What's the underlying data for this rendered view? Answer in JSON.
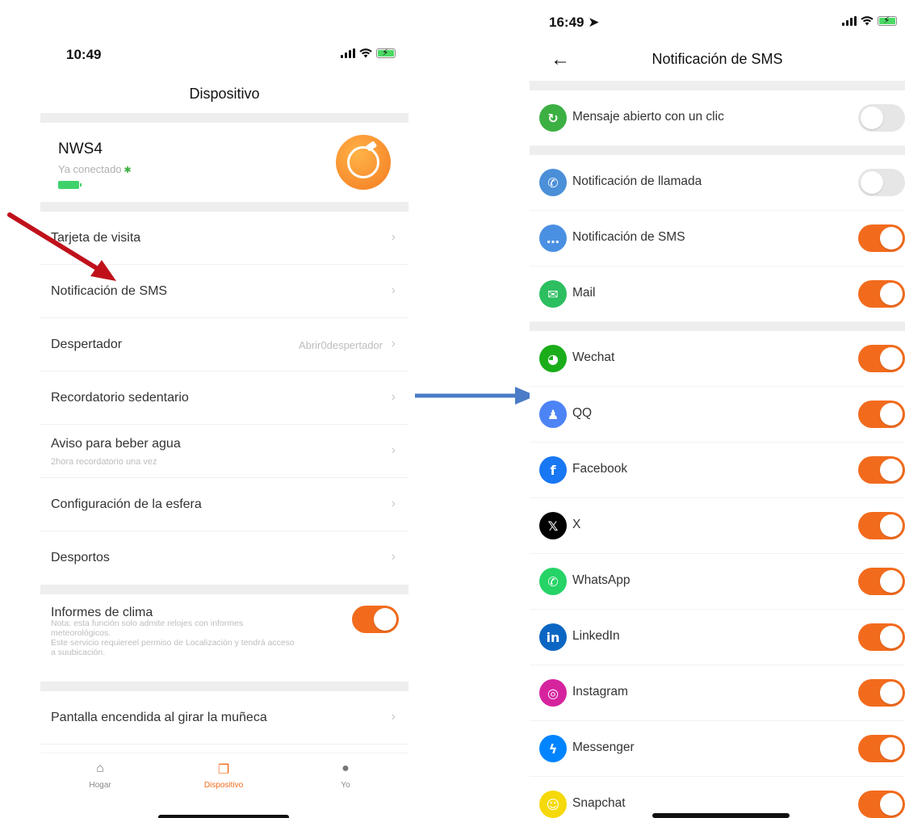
{
  "left_screen": {
    "status_time": "10:49",
    "title": "Dispositivo",
    "device": {
      "name": "NWS4",
      "status": "Ya conectado"
    },
    "menu": [
      {
        "label": "Tarjeta de visita"
      },
      {
        "label": "Notificación de SMS"
      },
      {
        "label": "Despertador",
        "value": "Abrir0despertador"
      },
      {
        "label": "Recordatorio sedentario"
      },
      {
        "label": "Aviso para beber agua",
        "sub": "2hora recordatorio una vez"
      },
      {
        "label": "Configuración de la esfera"
      },
      {
        "label": "Desportos"
      }
    ],
    "weather": {
      "label": "Informes de clima",
      "note": "Nota: esta función solo admite relojes con informes meteorológicos.\nEste servicio requiereel permiso de Localización y tendrá acceso a suubicación.",
      "enabled": true
    },
    "wrist": {
      "label": "Pantalla encendida al girar la muñeca"
    },
    "tabs": [
      {
        "label": "Hogar",
        "icon": "home-icon"
      },
      {
        "label": "Dispositivo",
        "icon": "device-icon",
        "active": true
      },
      {
        "label": "Yo",
        "icon": "person-icon"
      }
    ]
  },
  "right_screen": {
    "status_time": "16:49",
    "title": "Notificación de SMS",
    "items": [
      {
        "label": "Mensaje abierto con un clic",
        "icon": "one-click-icon",
        "color": "#3cb043",
        "on": false
      },
      {
        "label": "Notificación de llamada",
        "icon": "phone-icon",
        "color": "#4a8fd8",
        "on": false
      },
      {
        "label": "Notificación de SMS",
        "icon": "sms-icon",
        "color": "#4a90e2",
        "on": true
      },
      {
        "label": "Mail",
        "icon": "mail-icon",
        "color": "#2dbe60",
        "on": true
      },
      {
        "label": "Wechat",
        "icon": "wechat-icon",
        "color": "#1aad19",
        "on": true
      },
      {
        "label": "QQ",
        "icon": "qq-icon",
        "color": "#4d84f5",
        "on": true
      },
      {
        "label": "Facebook",
        "icon": "facebook-icon",
        "color": "#1877f2",
        "on": true
      },
      {
        "label": "X",
        "icon": "x-icon",
        "color": "#000000",
        "on": true
      },
      {
        "label": "WhatsApp",
        "icon": "whatsapp-icon",
        "color": "#25d366",
        "on": true
      },
      {
        "label": "LinkedIn",
        "icon": "linkedin-icon",
        "color": "#0a66c2",
        "on": true
      },
      {
        "label": "Instagram",
        "icon": "instagram-icon",
        "color": "#d6249f",
        "on": true
      },
      {
        "label": "Messenger",
        "icon": "messenger-icon",
        "color": "#0084ff",
        "on": true
      },
      {
        "label": "Snapchat",
        "icon": "snapchat-icon",
        "color": "#f5d90a",
        "on": true
      }
    ]
  },
  "colors": {
    "accent": "#f26b1d",
    "red_arrow": "#c0111b",
    "blue_arrow": "#4a7cc7"
  }
}
